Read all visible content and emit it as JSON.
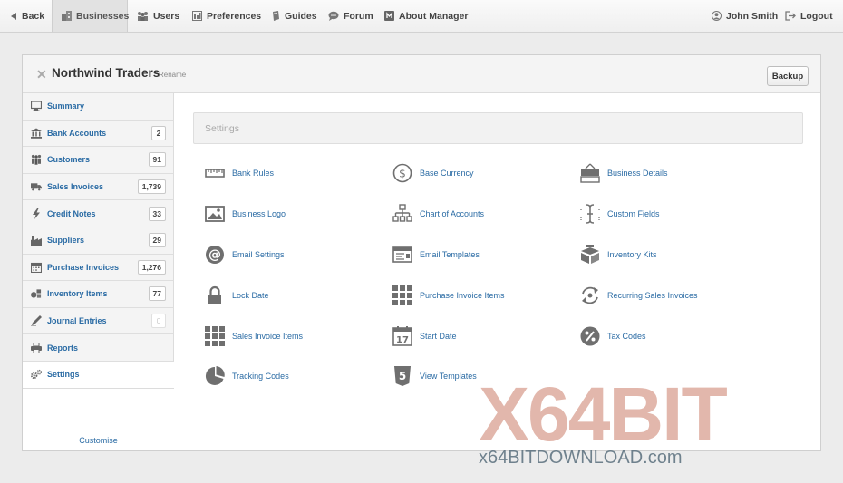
{
  "nav": {
    "back": "Back",
    "businesses": "Businesses",
    "users": "Users",
    "preferences": "Preferences",
    "guides": "Guides",
    "forum": "Forum",
    "about": "About Manager",
    "user": "John Smith",
    "logout": "Logout"
  },
  "business": {
    "name": "Northwind Traders",
    "rename": "Rename",
    "backup": "Backup"
  },
  "sidebar": {
    "items": [
      {
        "label": "Summary",
        "icon": "monitor-icon",
        "count": ""
      },
      {
        "label": "Bank Accounts",
        "icon": "bank-icon",
        "count": "2"
      },
      {
        "label": "Customers",
        "icon": "people-icon",
        "count": "91"
      },
      {
        "label": "Sales Invoices",
        "icon": "truck-icon",
        "count": "1,739"
      },
      {
        "label": "Credit Notes",
        "icon": "lightning-icon",
        "count": "33"
      },
      {
        "label": "Suppliers",
        "icon": "factory-icon",
        "count": "29"
      },
      {
        "label": "Purchase Invoices",
        "icon": "calendar-icon",
        "count": "1,276"
      },
      {
        "label": "Inventory Items",
        "icon": "boxes-icon",
        "count": "77"
      },
      {
        "label": "Journal Entries",
        "icon": "pen-icon",
        "count": "0"
      },
      {
        "label": "Reports",
        "icon": "printer-icon",
        "count": ""
      },
      {
        "label": "Settings",
        "icon": "gears-icon",
        "count": ""
      }
    ],
    "customise": "Customise"
  },
  "settings": {
    "title": "Settings",
    "items": [
      {
        "label": "Bank Rules",
        "icon": "ruler-icon"
      },
      {
        "label": "Base Currency",
        "icon": "dollar-icon"
      },
      {
        "label": "Business Details",
        "icon": "sign-icon"
      },
      {
        "label": "Business Logo",
        "icon": "picture-icon"
      },
      {
        "label": "Chart of Accounts",
        "icon": "org-chart-icon"
      },
      {
        "label": "Custom Fields",
        "icon": "text-cursor-icon"
      },
      {
        "label": "Email Settings",
        "icon": "at-icon"
      },
      {
        "label": "Email Templates",
        "icon": "envelope-icon"
      },
      {
        "label": "Inventory Kits",
        "icon": "boxes-icon"
      },
      {
        "label": "Lock Date",
        "icon": "lock-icon"
      },
      {
        "label": "Purchase Invoice Items",
        "icon": "grid-icon"
      },
      {
        "label": "Recurring Sales Invoices",
        "icon": "refresh-icon"
      },
      {
        "label": "Sales Invoice Items",
        "icon": "grid-icon"
      },
      {
        "label": "Start Date",
        "icon": "calendar-17-icon"
      },
      {
        "label": "Tax Codes",
        "icon": "percent-icon"
      },
      {
        "label": "Tracking Codes",
        "icon": "pie-icon"
      },
      {
        "label": "View Templates",
        "icon": "html5-icon"
      }
    ]
  },
  "watermark": {
    "brand": "X64BIT",
    "site": "x64BITDOWNLOAD.com"
  },
  "colors": {
    "link": "#2a6ba4",
    "icon": "#6f6f6f"
  }
}
